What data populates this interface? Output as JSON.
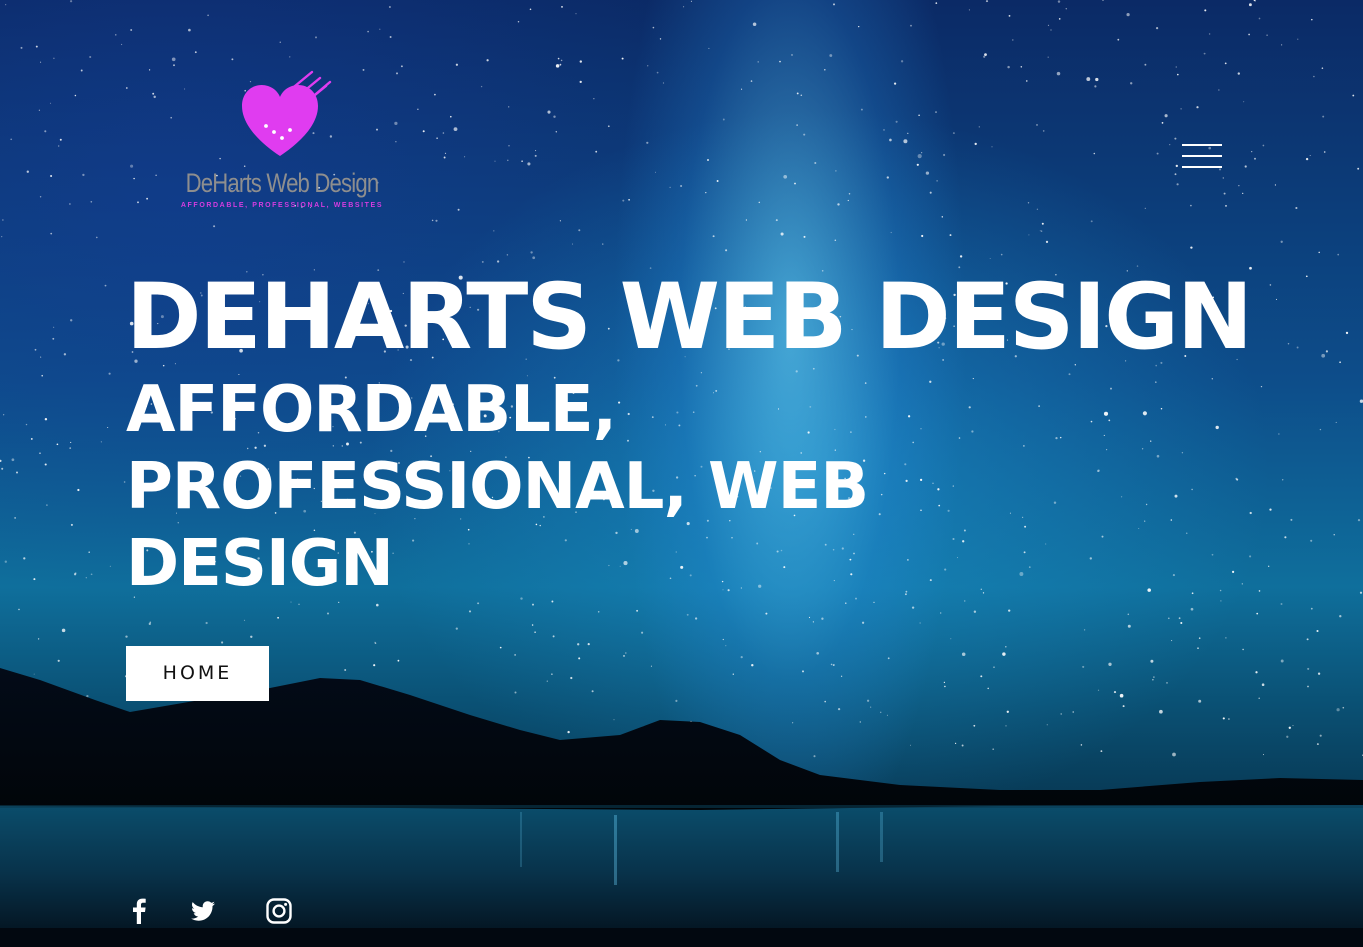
{
  "brand": {
    "logo_name": "DeHarts Web Design",
    "logo_tagline": "AFFORDABLE, PROFESSIONAL, WEBSITES",
    "logo_icon": "heart-circuit-icon",
    "logo_color": "#e03cf0"
  },
  "header": {
    "menu_icon": "hamburger-menu-icon"
  },
  "hero": {
    "title": "DEHARTS WEB DESIGN",
    "subtitle": "AFFORDABLE, PROFESSIONAL, WEB DESIGN",
    "cta_label": "HOME"
  },
  "social": [
    {
      "icon": "facebook-icon"
    },
    {
      "icon": "twitter-icon"
    },
    {
      "icon": "instagram-icon"
    }
  ],
  "colors": {
    "text": "#ffffff",
    "button_bg": "#ffffff",
    "button_text": "#111111",
    "logo_text": "#8e8e8e",
    "accent": "#d43ce0"
  }
}
